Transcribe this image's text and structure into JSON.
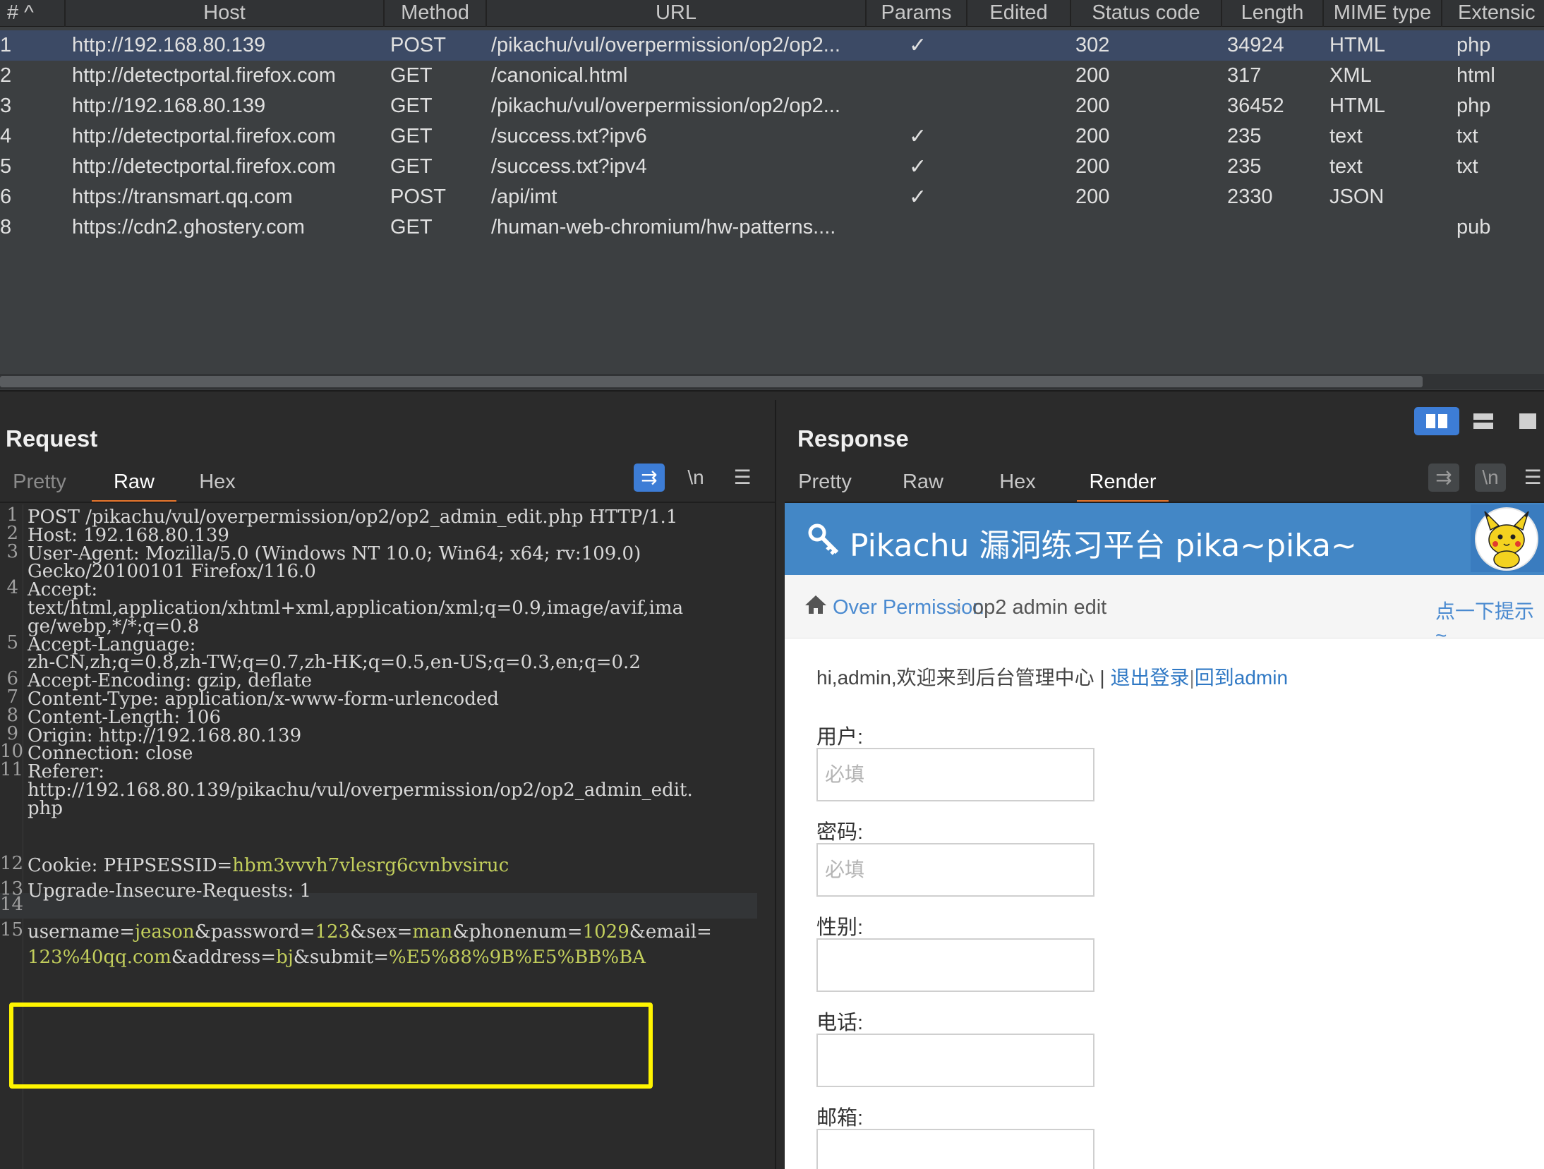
{
  "history": {
    "columns": [
      "# ^",
      "Host",
      "Method",
      "URL",
      "Params",
      "Edited",
      "Status code",
      "Length",
      "MIME type",
      "Extensic"
    ],
    "rows": [
      {
        "num": "1",
        "host": "http://192.168.80.139",
        "method": "POST",
        "url": "/pikachu/vul/overpermission/op2/op2...",
        "params": "✓",
        "status": "302",
        "length": "34924",
        "mime": "HTML",
        "ext": "php",
        "selected": true
      },
      {
        "num": "2",
        "host": "http://detectportal.firefox.com",
        "method": "GET",
        "url": "/canonical.html",
        "params": "",
        "status": "200",
        "length": "317",
        "mime": "XML",
        "ext": "html"
      },
      {
        "num": "3",
        "host": "http://192.168.80.139",
        "method": "GET",
        "url": "/pikachu/vul/overpermission/op2/op2...",
        "params": "",
        "status": "200",
        "length": "36452",
        "mime": "HTML",
        "ext": "php"
      },
      {
        "num": "4",
        "host": "http://detectportal.firefox.com",
        "method": "GET",
        "url": "/success.txt?ipv6",
        "params": "✓",
        "status": "200",
        "length": "235",
        "mime": "text",
        "ext": "txt"
      },
      {
        "num": "5",
        "host": "http://detectportal.firefox.com",
        "method": "GET",
        "url": "/success.txt?ipv4",
        "params": "✓",
        "status": "200",
        "length": "235",
        "mime": "text",
        "ext": "txt"
      },
      {
        "num": "6",
        "host": "https://transmart.qq.com",
        "method": "POST",
        "url": "/api/imt",
        "params": "✓",
        "status": "200",
        "length": "2330",
        "mime": "JSON",
        "ext": ""
      },
      {
        "num": "8",
        "host": "https://cdn2.ghostery.com",
        "method": "GET",
        "url": "/human-web-chromium/hw-patterns....",
        "params": "",
        "status": "",
        "length": "",
        "mime": "",
        "ext": "pub"
      }
    ]
  },
  "request": {
    "title": "Request",
    "tabs": [
      "Pretty",
      "Raw",
      "Hex"
    ],
    "active_tab": "Raw",
    "icons": {
      "wrap": "⇉",
      "newline": "\\n",
      "menu": "☰"
    },
    "lines": [
      {
        "n": "1",
        "text": "POST /pikachu/vul/overpermission/op2/op2_admin_edit.php HTTP/1.1"
      },
      {
        "n": "2",
        "text": "Host: 192.168.80.139"
      },
      {
        "n": "3",
        "text": "User-Agent: Mozilla/5.0 (Windows NT 10.0; Win64; x64; rv:109.0)"
      },
      {
        "n": "",
        "text": "Gecko/20100101 Firefox/116.0"
      },
      {
        "n": "4",
        "text": "Accept:"
      },
      {
        "n": "",
        "text": "text/html,application/xhtml+xml,application/xml;q=0.9,image/avif,ima"
      },
      {
        "n": "",
        "text": "ge/webp,*/*;q=0.8"
      },
      {
        "n": "5",
        "text": "Accept-Language:"
      },
      {
        "n": "",
        "text": "zh-CN,zh;q=0.8,zh-TW;q=0.7,zh-HK;q=0.5,en-US;q=0.3,en;q=0.2"
      },
      {
        "n": "6",
        "text": "Accept-Encoding: gzip, deflate"
      },
      {
        "n": "7",
        "text": "Content-Type: application/x-www-form-urlencoded"
      },
      {
        "n": "8",
        "text": "Content-Length: 106"
      },
      {
        "n": "9",
        "text": "Origin: http://192.168.80.139"
      },
      {
        "n": "10",
        "text": "Connection: close"
      },
      {
        "n": "11",
        "text": "Referer:"
      },
      {
        "n": "",
        "text": "http://192.168.80.139/pikachu/vul/overpermission/op2/op2_admin_edit."
      },
      {
        "n": "",
        "text": "php"
      }
    ],
    "cookie": {
      "n": "12",
      "prefix": "Cookie: PHPSESSID=",
      "value": "hbm3vvvh7vlesrg6cvnbvsiruc"
    },
    "line13": {
      "n": "13",
      "text": "Upgrade-Insecure-Requests: 1"
    },
    "line14": {
      "n": "14",
      "text": ""
    },
    "body": {
      "n": "15",
      "line1": [
        {
          "t": "username=",
          "c": 0
        },
        {
          "t": "jeason",
          "c": 1
        },
        {
          "t": "&password=",
          "c": 0
        },
        {
          "t": "123",
          "c": 1
        },
        {
          "t": "&sex=",
          "c": 0
        },
        {
          "t": "man",
          "c": 1
        },
        {
          "t": "&phonenum=",
          "c": 0
        },
        {
          "t": "1029",
          "c": 1
        },
        {
          "t": "&email=",
          "c": 0
        }
      ],
      "line2": [
        {
          "t": "123%40qq.com",
          "c": 1
        },
        {
          "t": "&address=",
          "c": 0
        },
        {
          "t": "bj",
          "c": 1
        },
        {
          "t": "&submit=",
          "c": 0
        },
        {
          "t": "%E5%88%9B%E5%BB%BA",
          "c": 1
        }
      ]
    }
  },
  "response": {
    "title": "Response",
    "tabs": [
      "Pretty",
      "Raw",
      "Hex",
      "Render"
    ],
    "active_tab": "Render",
    "icons": {
      "wrap": "⇉",
      "newline": "\\n",
      "menu": "☰"
    },
    "render": {
      "site_title": "Pikachu 漏洞练习平台 pika~pika~",
      "breadcrumb_section": "Over Permission",
      "breadcrumb_page": "op2 admin edit",
      "hint_link": "点一下提示~",
      "welcome": "hi,admin,欢迎来到后台管理中心 |",
      "logout_link": "退出登录",
      "separator": "|",
      "back_link": "回到admin",
      "fields": [
        {
          "label": "用户:",
          "placeholder": "必填"
        },
        {
          "label": "密码:",
          "placeholder": "必填"
        },
        {
          "label": "性别:",
          "placeholder": ""
        },
        {
          "label": "电话:",
          "placeholder": ""
        },
        {
          "label": "邮箱:",
          "placeholder": ""
        }
      ]
    }
  },
  "colors": {
    "selected_row": "#3c4a65",
    "accent_tab": "#e8762c",
    "highlight_value": "#c3cf5c",
    "pikachu_header": "#4387c6",
    "annotation_box": "#fff500"
  }
}
